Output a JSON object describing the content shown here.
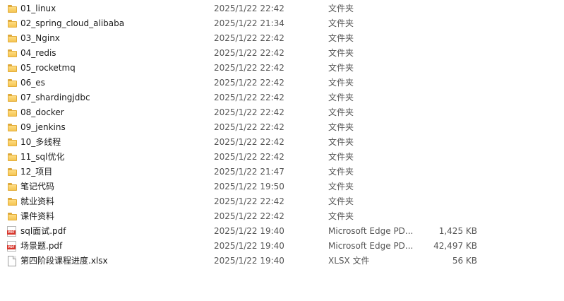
{
  "files": [
    {
      "name": "01_linux",
      "date": "2025/1/22 22:42",
      "type": "文件夹",
      "size": "",
      "icon": "folder-icon"
    },
    {
      "name": "02_spring_cloud_alibaba",
      "date": "2025/1/22 21:34",
      "type": "文件夹",
      "size": "",
      "icon": "folder-icon"
    },
    {
      "name": "03_Nginx",
      "date": "2025/1/22 22:42",
      "type": "文件夹",
      "size": "",
      "icon": "folder-icon"
    },
    {
      "name": "04_redis",
      "date": "2025/1/22 22:42",
      "type": "文件夹",
      "size": "",
      "icon": "folder-icon"
    },
    {
      "name": "05_rocketmq",
      "date": "2025/1/22 22:42",
      "type": "文件夹",
      "size": "",
      "icon": "folder-icon"
    },
    {
      "name": "06_es",
      "date": "2025/1/22 22:42",
      "type": "文件夹",
      "size": "",
      "icon": "folder-icon"
    },
    {
      "name": "07_shardingjdbc",
      "date": "2025/1/22 22:42",
      "type": "文件夹",
      "size": "",
      "icon": "folder-icon"
    },
    {
      "name": "08_docker",
      "date": "2025/1/22 22:42",
      "type": "文件夹",
      "size": "",
      "icon": "folder-icon"
    },
    {
      "name": "09_jenkins",
      "date": "2025/1/22 22:42",
      "type": "文件夹",
      "size": "",
      "icon": "folder-icon"
    },
    {
      "name": "10_多线程",
      "date": "2025/1/22 22:42",
      "type": "文件夹",
      "size": "",
      "icon": "folder-icon"
    },
    {
      "name": "11_sql优化",
      "date": "2025/1/22 22:42",
      "type": "文件夹",
      "size": "",
      "icon": "folder-icon"
    },
    {
      "name": "12_项目",
      "date": "2025/1/22 21:47",
      "type": "文件夹",
      "size": "",
      "icon": "folder-icon"
    },
    {
      "name": "笔记代码",
      "date": "2025/1/22 19:50",
      "type": "文件夹",
      "size": "",
      "icon": "folder-icon"
    },
    {
      "name": "就业资料",
      "date": "2025/1/22 22:42",
      "type": "文件夹",
      "size": "",
      "icon": "folder-icon"
    },
    {
      "name": "课件资料",
      "date": "2025/1/22 22:42",
      "type": "文件夹",
      "size": "",
      "icon": "folder-icon"
    },
    {
      "name": "sql面试.pdf",
      "date": "2025/1/22 19:40",
      "type": "Microsoft Edge PD...",
      "size": "1,425 KB",
      "icon": "pdf-icon",
      "icon_text": "PDF"
    },
    {
      "name": "场景题.pdf",
      "date": "2025/1/22 19:40",
      "type": "Microsoft Edge PD...",
      "size": "42,497 KB",
      "icon": "pdf-icon",
      "icon_text": "PDF"
    },
    {
      "name": "第四阶段课程进度.xlsx",
      "date": "2025/1/22 19:40",
      "type": "XLSX 文件",
      "size": "56 KB",
      "icon": "document-icon"
    }
  ]
}
